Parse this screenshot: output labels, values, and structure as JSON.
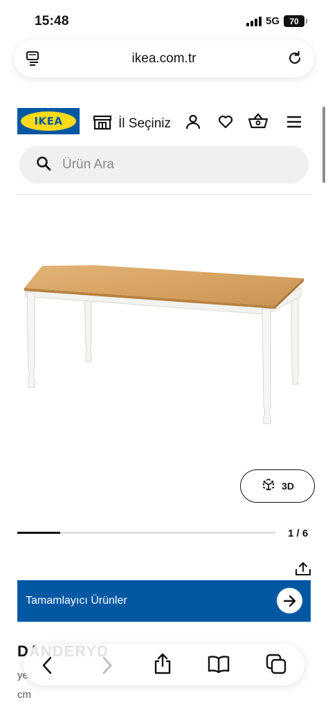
{
  "status_bar": {
    "time": "15:48",
    "network": "5G",
    "battery": "70"
  },
  "browser": {
    "url": "ikea.com.tr"
  },
  "header": {
    "logo_text": "IKEA",
    "store_label": "İl Seçiniz"
  },
  "search": {
    "placeholder": "Ürün Ara"
  },
  "gallery": {
    "button_3d": "3D",
    "counter": "1 / 6",
    "progress": 0.167
  },
  "banner": {
    "label": "Tamamlayıcı Ürünler"
  },
  "product": {
    "title": "DANDERYD",
    "description_start": "ye",
    "description_end": "cm"
  },
  "colors": {
    "brand_blue": "#0058a3",
    "brand_yellow": "#ffda1a"
  }
}
